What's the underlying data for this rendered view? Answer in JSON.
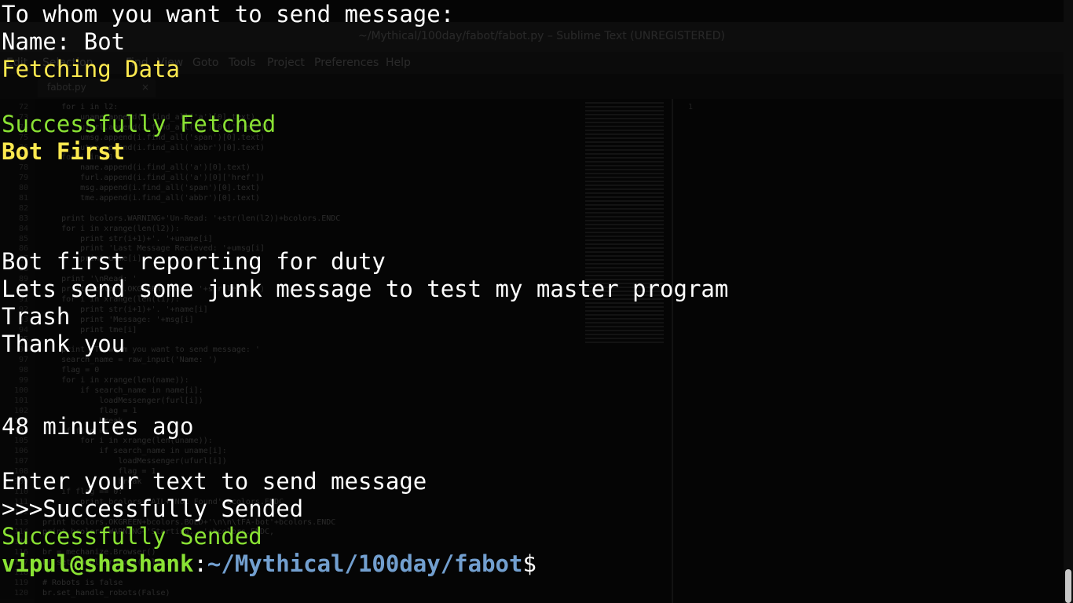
{
  "background_editor": {
    "window_title": "~/Mythical/100day/fabot/fabot.py – Sublime Text (UNREGISTERED)",
    "menu": [
      "Edit",
      "Selection",
      "Find",
      "View",
      "Goto",
      "Tools",
      "Project",
      "Preferences",
      "Help"
    ],
    "tab": {
      "label": "fabot.py",
      "close": "×"
    },
    "code_lines": [
      {
        "n": "72",
        "t": "    for i in l2:"
      },
      {
        "n": "73",
        "t": "        uname.append(i.find_all('a')[0].text)"
      },
      {
        "n": "74",
        "t": "        ufurl.append(i.find_all('a')[0]['href'])"
      },
      {
        "n": "75",
        "t": "        umsg.append(i.find_all('span')[0].text)"
      },
      {
        "n": "76",
        "t": "        utme.append(i.find_all('abbr')[0].text)"
      },
      {
        "n": "77",
        "t": "    for i in l1:"
      },
      {
        "n": "78",
        "t": "        name.append(i.find_all('a')[0].text)"
      },
      {
        "n": "79",
        "t": "        furl.append(i.find_all('a')[0]['href'])"
      },
      {
        "n": "80",
        "t": "        msg.append(i.find_all('span')[0].text)"
      },
      {
        "n": "81",
        "t": "        tme.append(i.find_all('abbr')[0].text)"
      },
      {
        "n": "82",
        "t": ""
      },
      {
        "n": "83",
        "t": "    print bcolors.WARNING+'Un-Read: '+str(len(l2))+bcolors.ENDC"
      },
      {
        "n": "84",
        "t": "    for i in xrange(len(l2)):"
      },
      {
        "n": "85",
        "t": "        print str(i+1)+'. '+uname[i]"
      },
      {
        "n": "86",
        "t": "        print 'Last Message Recieved: '+umsg[i]"
      },
      {
        "n": "87",
        "t": "        print utme[i]"
      },
      {
        "n": "88",
        "t": ""
      },
      {
        "n": "89",
        "t": "    print '\\nRead: '"
      },
      {
        "n": "90",
        "t": "    print bcolors.OKGREEN+'Read: '+str(len(l1))"
      },
      {
        "n": "91",
        "t": "    for i in xrange(len(l1)):"
      },
      {
        "n": "92",
        "t": "        print str(i+1)+'. '+name[i]"
      },
      {
        "n": "93",
        "t": "        print 'Message: '+msg[i]"
      },
      {
        "n": "94",
        "t": "        print tme[i]"
      },
      {
        "n": "95",
        "t": ""
      },
      {
        "n": "96",
        "t": "    print 'To whom you want to send message: '"
      },
      {
        "n": "97",
        "t": "    search_name = raw_input('Name: ')"
      },
      {
        "n": "98",
        "t": "    flag = 0"
      },
      {
        "n": "99",
        "t": "    for i in xrange(len(name)):"
      },
      {
        "n": "100",
        "t": "        if search_name in name[i]:"
      },
      {
        "n": "101",
        "t": "            loadMessenger(furl[i])"
      },
      {
        "n": "102",
        "t": "            flag = 1"
      },
      {
        "n": "103",
        "t": "            break"
      },
      {
        "n": "104",
        "t": "    if flag == 0:"
      },
      {
        "n": "105",
        "t": "        for i in xrange(len(uname)):"
      },
      {
        "n": "106",
        "t": "            if search_name in uname[i]:"
      },
      {
        "n": "107",
        "t": "                loadMessenger(ufurl[i])"
      },
      {
        "n": "108",
        "t": "                flag = 1"
      },
      {
        "n": "109",
        "t": "                break"
      },
      {
        "n": "110",
        "t": "    if flag == 0:"
      },
      {
        "n": "111",
        "t": "        print bcolors.FAIL+'Not Found'+bcolors.ENDC"
      },
      {
        "n": "112",
        "t": ""
      },
      {
        "n": "113",
        "t": "print bcolors.OKGREEN+bcolors.BOLD+'\\n\\n\\tFA-bot'+bcolors.ENDC"
      },
      {
        "n": "114",
        "t": "print bcolors.WARNING+'Starting...'+bcolors.ENDC,"
      },
      {
        "n": "115",
        "t": ""
      },
      {
        "n": "116",
        "t": "br = mechanize.Browser()"
      },
      {
        "n": "117",
        "t": "br.set_handle_robots(False)"
      },
      {
        "n": "118",
        "t": ""
      },
      {
        "n": "119",
        "t": "# Robots is false"
      },
      {
        "n": "120",
        "t": "br.set_handle_robots(False)"
      }
    ]
  },
  "terminal": {
    "lines": [
      {
        "text": "To whom you want to send message:",
        "style": "white"
      },
      {
        "text": "Name: Bot",
        "style": "white"
      },
      {
        "text": "Fetching Data",
        "style": "yellow"
      },
      {
        "text": "",
        "style": "white"
      },
      {
        "text": "Successfully Fetched",
        "style": "green"
      },
      {
        "text": "Bot First",
        "style": "yellow-bold"
      },
      {
        "text": "",
        "style": "white"
      },
      {
        "text": "",
        "style": "white"
      },
      {
        "text": "",
        "style": "white"
      },
      {
        "text": "Bot first reporting for duty",
        "style": "white"
      },
      {
        "text": "Lets send some junk message to test my master program",
        "style": "white"
      },
      {
        "text": "Trash",
        "style": "white"
      },
      {
        "text": "Thank you",
        "style": "white"
      },
      {
        "text": "",
        "style": "white"
      },
      {
        "text": "",
        "style": "white"
      },
      {
        "text": "48 minutes ago",
        "style": "white"
      },
      {
        "text": "",
        "style": "white"
      },
      {
        "text": "Enter your text to send message",
        "style": "white"
      },
      {
        "text": ">>>Successfully Sended",
        "style": "white"
      },
      {
        "text": "Successfully Sended",
        "style": "green"
      }
    ],
    "prompt": {
      "user_host": "vipul@shashank",
      "separator": ":",
      "path": "~/Mythical/100day/fabot",
      "symbol": "$"
    }
  },
  "colors": {
    "background": "#050505",
    "text": "#ffffff",
    "warning_yellow": "#fce94f",
    "success_green": "#8ae234",
    "path_blue": "#729fcf"
  }
}
